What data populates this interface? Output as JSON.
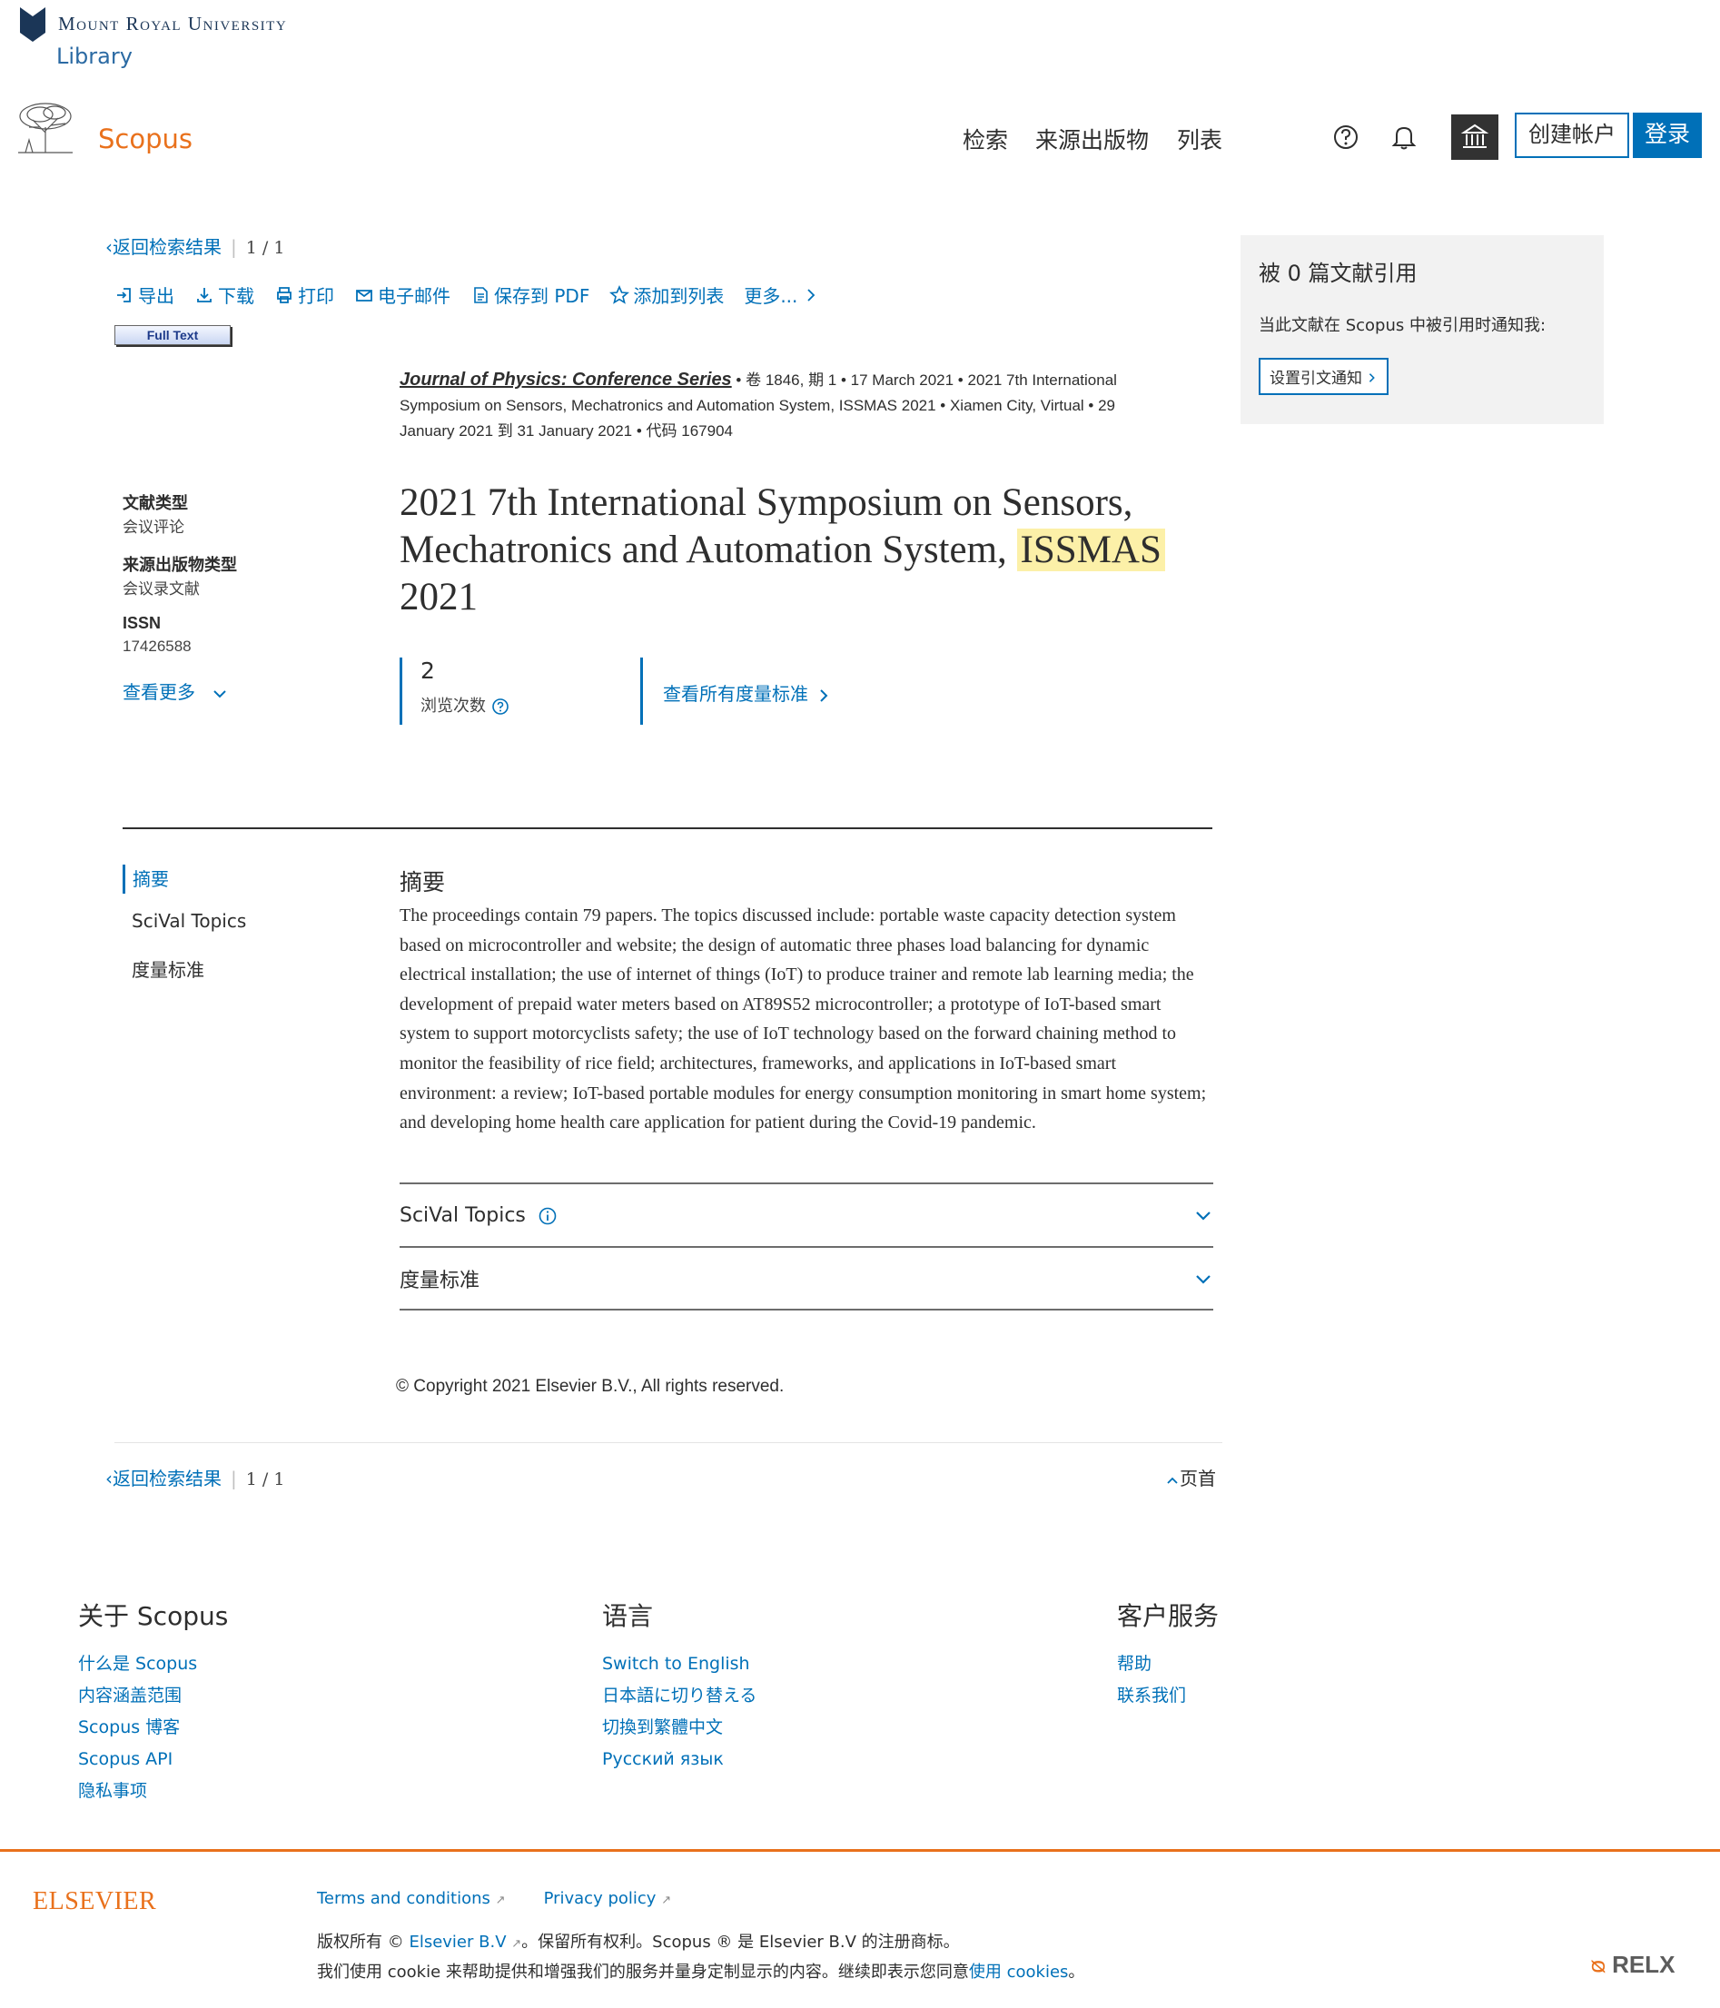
{
  "header": {
    "university_name": "Mount Royal University",
    "library_label": "Library",
    "product_name": "Scopus",
    "nav": [
      "检索",
      "来源出版物",
      "列表"
    ],
    "create_account": "创建帐户",
    "login": "登录"
  },
  "breadcrumb": {
    "back_label": "返回检索结果",
    "position": "1 / 1"
  },
  "toolbar": {
    "export": "导出",
    "download": "下载",
    "print": "打印",
    "email": "电子邮件",
    "save_pdf": "保存到 PDF",
    "add_list": "添加到列表",
    "more": "更多..."
  },
  "full_text_label": "Full Text",
  "source": {
    "journal": "Journal of Physics: Conference Series",
    "volume_issue": "卷 1846, 期 1",
    "date": "17 March 2021",
    "conference": "2021 7th International Symposium on Sensors, Mechatronics and Automation System, ISSMAS 2021",
    "location": "Xiamen City, Virtual",
    "conf_dates": "29 January 2021 到 31 January 2021",
    "code": "代码 167904"
  },
  "meta": {
    "doc_type_label": "文献类型",
    "doc_type_value": "会议评论",
    "src_type_label": "来源出版物类型",
    "src_type_value": "会议录文献",
    "issn_label": "ISSN",
    "issn_value": "17426588",
    "view_more": "查看更多"
  },
  "title": {
    "before": "2021 7th International Symposium on Sensors, Mechatronics and Automation System,",
    "highlight": "ISSMAS",
    "after": "2021"
  },
  "metrics": {
    "views_count": "2",
    "views_label": "浏览次数",
    "view_all": "查看所有度量标准"
  },
  "side_nav": [
    "摘要",
    "SciVal Topics",
    "度量标准"
  ],
  "abstract": {
    "heading": "摘要",
    "text": "The proceedings contain 79 papers. The topics discussed include: portable waste capacity detection system based on microcontroller and website; the design of automatic three phases load balancing for dynamic electrical installation; the use of internet of things (IoT) to produce trainer and remote lab learning media; the development of prepaid water meters based on AT89S52 microcontroller; a prototype of IoT-based smart system to support motorcyclists safety; the use of IoT technology based on the forward chaining method to monitor the feasibility of rice field; architectures, frameworks, and applications in IoT-based smart environment: a review; IoT-based portable modules for energy consumption monitoring in smart home system; and developing home health care application for patient during the Covid-19 pandemic."
  },
  "accordions": [
    "SciVal Topics",
    "度量标准"
  ],
  "copyright": "Copyright 2021 Elsevier B.V., All rights reserved.",
  "top_link": "页首",
  "cite_panel": {
    "title": "被 0 篇文献引用",
    "desc": "当此文献在 Scopus 中被引用时通知我:",
    "button": "设置引文通知"
  },
  "footer": {
    "about_head": "关于 Scopus",
    "about_links": [
      "什么是 Scopus",
      "内容涵盖范围",
      "Scopus 博客",
      "Scopus API",
      "隐私事项"
    ],
    "lang_head": "语言",
    "lang_links": [
      "Switch to English",
      "日本語に切り替える",
      "切換到繁體中文",
      "Русский язык"
    ],
    "service_head": "客户服务",
    "service_links": [
      "帮助",
      "联系我们"
    ],
    "elsevier": "ELSEVIER",
    "terms": "Terms and conditions",
    "privacy": "Privacy policy",
    "rights_pre": "版权所有",
    "rights_link": "Elsevier B.V",
    "rights_post": "。保留所有权利。Scopus ® 是 Elsevier B.V 的注册商标。",
    "cookie_pre": "我们使用 cookie 来帮助提供和增强我们的服务并量身定制显示的内容。继续即表示您同意",
    "cookie_link": "使用 cookies",
    "cookie_post": "。",
    "relx": "RELX"
  },
  "colors": {
    "accent": "#0070b8",
    "brand_orange": "#e9711c",
    "highlight": "#fcf0a8"
  }
}
